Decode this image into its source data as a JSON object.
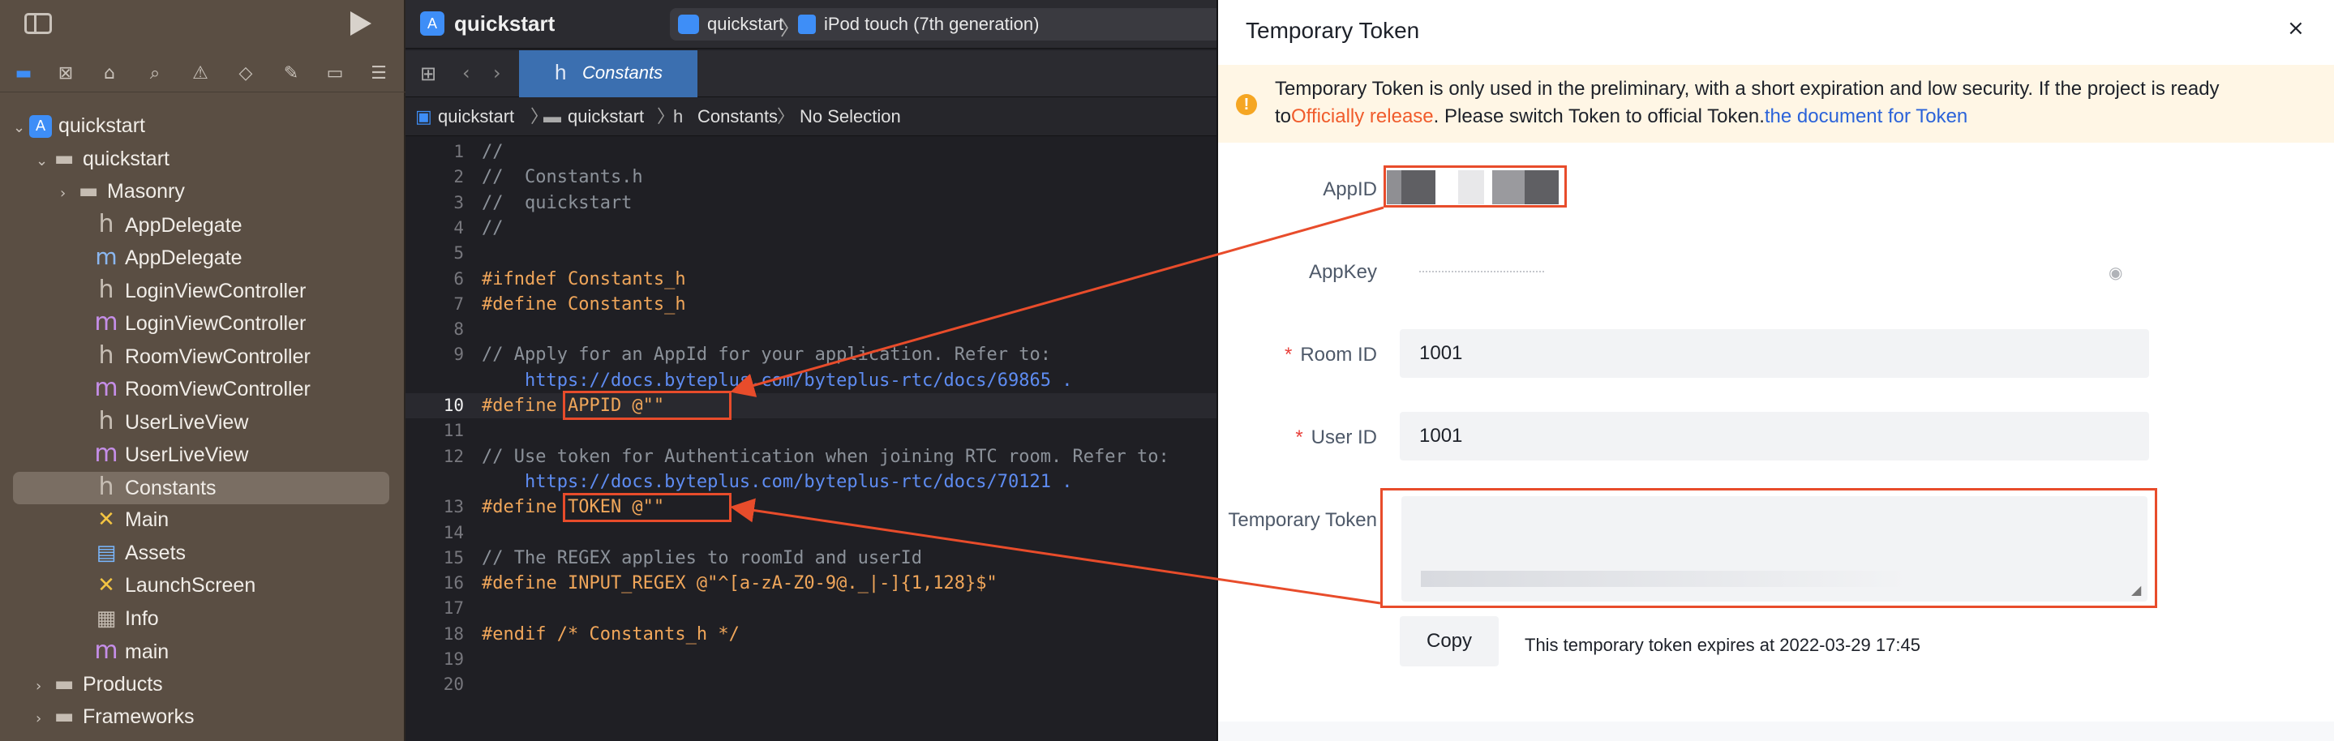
{
  "sidebar": {
    "tree": [
      {
        "label": "quickstart",
        "icon": "project-icon",
        "chev": "⌄"
      },
      {
        "label": "quickstart",
        "icon": "folder-icon",
        "chev": "⌄"
      },
      {
        "label": "Masonry",
        "icon": "folder-icon",
        "chev": "›"
      },
      {
        "label": "AppDelegate",
        "icon": "h"
      },
      {
        "label": "AppDelegate",
        "icon": "m'"
      },
      {
        "label": "LoginViewController",
        "icon": "h"
      },
      {
        "label": "LoginViewController",
        "icon": "m"
      },
      {
        "label": "RoomViewController",
        "icon": "h"
      },
      {
        "label": "RoomViewController",
        "icon": "m"
      },
      {
        "label": "UserLiveView",
        "icon": "h"
      },
      {
        "label": "UserLiveView",
        "icon": "m"
      },
      {
        "label": "Constants",
        "icon": "h"
      },
      {
        "label": "Main",
        "icon": "x"
      },
      {
        "label": "Assets",
        "icon": "assets"
      },
      {
        "label": "LaunchScreen",
        "icon": "x"
      },
      {
        "label": "Info",
        "icon": "plist"
      },
      {
        "label": "main",
        "icon": "m"
      },
      {
        "label": "Products",
        "icon": "folder-icon",
        "chev": "›"
      },
      {
        "label": "Frameworks",
        "icon": "folder-icon",
        "chev": "›"
      }
    ]
  },
  "editor": {
    "app_name": "quickstart",
    "scheme_target": "quickstart",
    "scheme_device": "iPod touch (7th generation)",
    "tab_label": "Constants",
    "breadcrumb": [
      "quickstart",
      "quickstart",
      "Constants",
      "No Selection"
    ],
    "lines": [
      {
        "n": "1",
        "text": "//",
        "cls": "c-cmt"
      },
      {
        "n": "2",
        "text": "//  Constants.h",
        "cls": "c-cmt"
      },
      {
        "n": "3",
        "text": "//  quickstart",
        "cls": "c-cmt"
      },
      {
        "n": "4",
        "text": "//",
        "cls": "c-cmt"
      },
      {
        "n": "5",
        "text": "",
        "cls": ""
      },
      {
        "n": "6",
        "text": "#ifndef Constants_h",
        "cls": "c-pre"
      },
      {
        "n": "7",
        "text": "#define Constants_h",
        "cls": "c-pre"
      },
      {
        "n": "8",
        "text": "",
        "cls": ""
      },
      {
        "n": "9",
        "text": "// Apply for an AppId for your application. Refer to:",
        "cls": "c-cmt"
      },
      {
        "n": "",
        "text": "    https://docs.byteplus.com/byteplus-rtc/docs/69865 .",
        "cls": "c-url"
      },
      {
        "n": "10",
        "text": "#define APPID @\"\"",
        "cls": "c-pre"
      },
      {
        "n": "11",
        "text": "",
        "cls": ""
      },
      {
        "n": "12",
        "text": "// Use token for Authentication when joining RTC room. Refer to:",
        "cls": "c-cmt"
      },
      {
        "n": "",
        "text": "    https://docs.byteplus.com/byteplus-rtc/docs/70121 .",
        "cls": "c-url"
      },
      {
        "n": "13",
        "text": "#define TOKEN @\"\"",
        "cls": "c-pre"
      },
      {
        "n": "14",
        "text": "",
        "cls": ""
      },
      {
        "n": "15",
        "text": "// The REGEX applies to roomId and userId",
        "cls": "c-cmt"
      },
      {
        "n": "16",
        "text": "#define INPUT_REGEX @\"^[a-zA-Z0-9@._|-]{1,128}$\"",
        "cls": "c-pre"
      },
      {
        "n": "17",
        "text": "",
        "cls": ""
      },
      {
        "n": "18",
        "text": "#endif /* Constants_h */",
        "cls": "c-pre"
      },
      {
        "n": "19",
        "text": "",
        "cls": ""
      },
      {
        "n": "20",
        "text": "",
        "cls": ""
      }
    ]
  },
  "dialog": {
    "title": "Temporary Token",
    "close": "×",
    "notice": {
      "line1": "Temporary Token is only used in the preliminary, with a short expiration and low security. If the project is ready",
      "line2_a": "to",
      "line2_red": "Officially release",
      "line2_b": ". Please switch Token to official Token.",
      "line2_link": "the document for Token"
    },
    "fields": {
      "appid_label": "AppID",
      "appkey_label": "AppKey",
      "roomid_label": "Room ID",
      "roomid_value": "1001",
      "userid_label": "User ID",
      "userid_value": "1001",
      "token_label": "Temporary Token",
      "required_mark": "*"
    },
    "copy_label": "Copy",
    "expire_text": "This temporary token expires at 2022-03-29 17:45"
  },
  "colors": {
    "highlight": "#e84c2b",
    "accent": "#3e8ef7"
  }
}
